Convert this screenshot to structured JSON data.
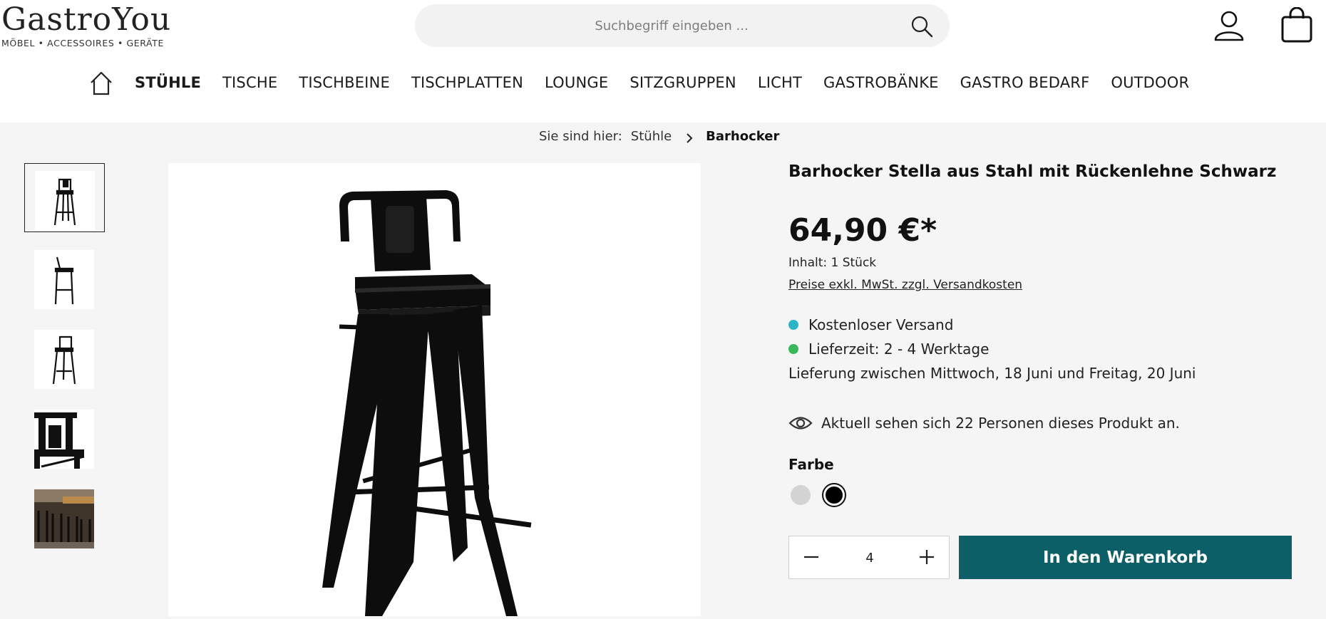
{
  "header": {
    "logo_main": "GastroYou",
    "logo_sub": "MÖBEL • ACCESSOIRES • GERÄTE",
    "search_placeholder": "Suchbegriff eingeben ...",
    "icons": {
      "search": "search-icon",
      "account": "user-icon",
      "cart": "shopping-bag-icon",
      "home": "home-icon"
    }
  },
  "nav": {
    "items": [
      {
        "label": "STÜHLE",
        "active": true
      },
      {
        "label": "TISCHE"
      },
      {
        "label": "TISCHBEINE"
      },
      {
        "label": "TISCHPLATTEN"
      },
      {
        "label": "LOUNGE"
      },
      {
        "label": "SITZGRUPPEN"
      },
      {
        "label": "LICHT"
      },
      {
        "label": "GASTROBÄNKE"
      },
      {
        "label": "GASTRO BEDARF"
      },
      {
        "label": "OUTDOOR"
      }
    ]
  },
  "breadcrumb": {
    "prefix": "Sie sind hier:",
    "parent": "Stühle",
    "current": "Barhocker"
  },
  "product": {
    "title": "Barhocker Stella aus Stahl mit Rückenlehne Schwarz",
    "price": "64,90 €*",
    "content": "Inhalt: 1 Stück",
    "tax_note": "Preise exkl. MwSt. zzgl. Versandkosten",
    "shipping": "Kostenloser Versand",
    "delivery_time": "Lieferzeit: 2 - 4 Werktage",
    "delivery_window": "Lieferung zwischen Mittwoch, 18 Juni und Freitag, 20 Juni",
    "viewers": "Aktuell sehen sich 22 Personen dieses Produkt an.",
    "color_label": "Farbe",
    "colors": [
      {
        "name": "grey",
        "hex": "#d3d3d3",
        "selected": false
      },
      {
        "name": "black",
        "hex": "#000000",
        "selected": true
      }
    ],
    "quantity": "4",
    "add_to_cart": "In den Warenkorb"
  },
  "colors": {
    "accent": "#0c5f66",
    "shipping_dot": "#2bb5c9",
    "delivery_dot": "#3cb85c",
    "page_bg": "#f5f5f5"
  }
}
